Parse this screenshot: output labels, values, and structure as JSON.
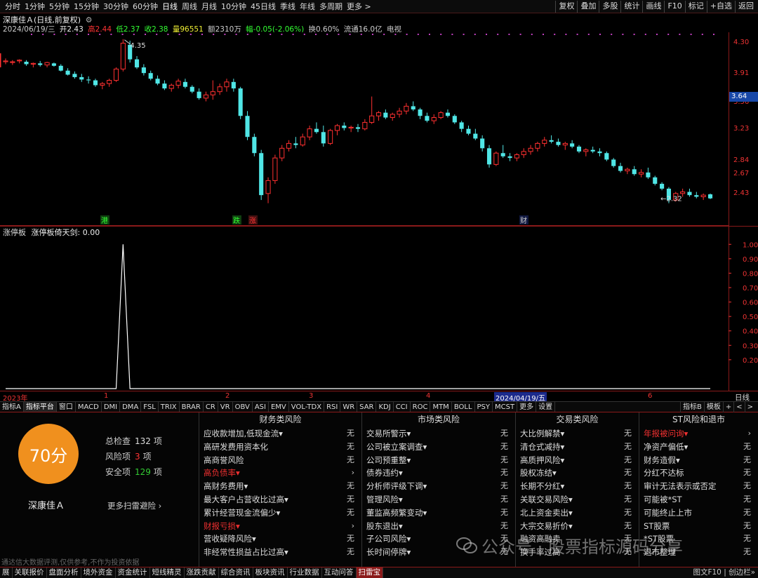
{
  "toolbar": {
    "periods": [
      "分时",
      "1分钟",
      "5分钟",
      "15分钟",
      "30分钟",
      "60分钟",
      "日线",
      "周线",
      "月线",
      "10分钟",
      "45日线",
      "季线",
      "年线",
      "多周期",
      "更多 >"
    ],
    "active_period": "日线",
    "right_buttons": [
      "复权",
      "叠加",
      "多股",
      "统计",
      "画线",
      "F10",
      "标记",
      "+自选",
      "返回"
    ]
  },
  "kline": {
    "title": "深康佳Ａ(日线,前复权)",
    "date": "2024/06/19/三",
    "open_label": "开2.43",
    "high_label": "高2.44",
    "low_label": "低2.37",
    "close_label": "收2.38",
    "volume_label": "量96551",
    "amount_label": "额2310万",
    "change_label": "幅-0.05(-2.06%)",
    "turnover_label": "换0.60%",
    "float_label": "流通16.0亿",
    "sector_label": "电视",
    "high_mark": "4.35",
    "low_mark": "←2.32",
    "price_ticks": [
      "4.30",
      "3.91",
      "3.56",
      "3.23",
      "2.84",
      "2.67",
      "2.43"
    ],
    "current_price": "3.64",
    "event_marks": [
      "港",
      "跌",
      "涨",
      "财"
    ]
  },
  "indicator": {
    "title": "涨停板",
    "subtitle": "涨停板倚天剑: 0.00",
    "ticks": [
      "1.00",
      "0.90",
      "0.80",
      "0.70",
      "0.60",
      "0.50",
      "0.40",
      "0.30",
      "0.20"
    ]
  },
  "timeaxis": {
    "labels": [
      "2023年",
      "1",
      "2",
      "3",
      "4",
      "6"
    ],
    "cursor_date": "2024/04/19/五",
    "period": "日线"
  },
  "indicator_tabs": [
    "指标A",
    "指标平台",
    "窗口",
    "MACD",
    "DMI",
    "DMA",
    "FSL",
    "TRIX",
    "BRAR",
    "CR",
    "VR",
    "OBV",
    "ASI",
    "EMV",
    "VOL-TDX",
    "RSI",
    "WR",
    "SAR",
    "KDJ",
    "CCI",
    "ROC",
    "MTM",
    "BOLL",
    "PSY",
    "MCST",
    "更多",
    "设置"
  ],
  "indicator_tabs_right": [
    "指标B",
    "模板",
    "+",
    "<",
    ">"
  ],
  "risk": {
    "score": "70分",
    "stock_name": "深康佳Ａ",
    "total_label": "总检查",
    "total_value": "132",
    "total_unit": "项",
    "risk_label": "风险项",
    "risk_value": "3",
    "risk_unit": "项",
    "safe_label": "安全项",
    "safe_value": "129",
    "safe_unit": "项",
    "more_scan": "更多扫雷避险 ›",
    "disclaimer": "通达信大数据评测,仅供参考,不作为投资依据",
    "columns": [
      {
        "title": "财务类风险",
        "items": [
          {
            "label": "应收款增加,低现金流▾",
            "value": "无"
          },
          {
            "label": "高研发费用资本化",
            "value": "无"
          },
          {
            "label": "高商誉风险",
            "value": "无"
          },
          {
            "label": "高负债率▾",
            "value": "›",
            "red": true
          },
          {
            "label": "高财务费用▾",
            "value": "无"
          },
          {
            "label": "最大客户占营收比过高▾",
            "value": "无"
          },
          {
            "label": "累计经营现金流偏少▾",
            "value": "无"
          },
          {
            "label": "财报亏损▾",
            "value": "›",
            "red": true
          },
          {
            "label": "营收疑降风险▾",
            "value": "无"
          },
          {
            "label": "非经常性损益占比过高▾",
            "value": "无"
          }
        ]
      },
      {
        "title": "市场类风险",
        "items": [
          {
            "label": "交易所警示▾",
            "value": "无"
          },
          {
            "label": "公司被立案调查▾",
            "value": "无"
          },
          {
            "label": "公司预重整▾",
            "value": "无"
          },
          {
            "label": "债券违约▾",
            "value": "无"
          },
          {
            "label": "分析师评级下调▾",
            "value": "无"
          },
          {
            "label": "管理风险▾",
            "value": "无"
          },
          {
            "label": "董监高频繁变动▾",
            "value": "无"
          },
          {
            "label": "股东退出▾",
            "value": "无"
          },
          {
            "label": "子公司风险▾",
            "value": "无"
          },
          {
            "label": "长时间停牌▾",
            "value": "无"
          }
        ]
      },
      {
        "title": "交易类风险",
        "items": [
          {
            "label": "大比例解禁▾",
            "value": "无"
          },
          {
            "label": "清仓式减持▾",
            "value": "无"
          },
          {
            "label": "高质押风险▾",
            "value": "无"
          },
          {
            "label": "股权冻结▾",
            "value": "无"
          },
          {
            "label": "长期不分红▾",
            "value": "无"
          },
          {
            "label": "关联交易风险▾",
            "value": "无"
          },
          {
            "label": "北上资金卖出▾",
            "value": "无"
          },
          {
            "label": "大宗交易折价▾",
            "value": "无"
          },
          {
            "label": "融资高融卖",
            "value": "无"
          },
          {
            "label": "换手率过高",
            "value": "无"
          }
        ]
      },
      {
        "title": "ST风险和退市",
        "items": [
          {
            "label": "年报被问询▾",
            "value": "›",
            "red": true
          },
          {
            "label": "净资产偏低▾",
            "value": "无"
          },
          {
            "label": "财务造假▾",
            "value": "无"
          },
          {
            "label": "分红不达标",
            "value": "无"
          },
          {
            "label": "审计无法表示或否定",
            "value": "无"
          },
          {
            "label": "可能被*ST",
            "value": "无"
          },
          {
            "label": "可能终止上市",
            "value": "无"
          },
          {
            "label": "ST股票",
            "value": "无"
          },
          {
            "label": "*ST股票",
            "value": "无"
          },
          {
            "label": "退市整理",
            "value": "无"
          }
        ]
      }
    ]
  },
  "watermark": "公众号 · 股票指标源码分享",
  "bottom_tabs": [
    "展",
    "关联报价",
    "盘面分析",
    "境外资金",
    "资金统计",
    "短线精灵",
    "涨跌贡献",
    "综合资讯",
    "板块资讯",
    "行业数据",
    "互动问答",
    "扫雷宝"
  ],
  "bottom_active": "扫雷宝",
  "bottom_right": "图文F10 | 创边栏»",
  "chart_data": {
    "type": "candlestick",
    "note_series": "daily OHLC, front-adjusted",
    "y_range": [
      2.3,
      4.4
    ],
    "candles": [
      [
        4.07,
        4.11,
        4.04,
        4.08
      ],
      [
        4.06,
        4.09,
        4.03,
        4.07
      ],
      [
        4.08,
        4.1,
        4.05,
        4.09
      ],
      [
        4.07,
        4.09,
        4.02,
        4.04
      ],
      [
        4.04,
        4.06,
        4.0,
        4.05
      ],
      [
        4.05,
        4.08,
        4.01,
        4.03
      ],
      [
        4.03,
        4.07,
        4.0,
        4.06
      ],
      [
        4.05,
        4.06,
        4.01,
        4.02
      ],
      [
        4.02,
        4.04,
        3.95,
        3.96
      ],
      [
        3.96,
        3.99,
        3.9,
        3.91
      ],
      [
        3.92,
        3.95,
        3.86,
        3.88
      ],
      [
        3.88,
        3.92,
        3.82,
        3.85
      ],
      [
        3.85,
        3.89,
        3.8,
        3.84
      ],
      [
        3.84,
        3.86,
        3.76,
        3.78
      ],
      [
        3.78,
        3.82,
        3.73,
        3.8
      ],
      [
        3.8,
        3.86,
        3.76,
        3.84
      ],
      [
        3.84,
        4.0,
        3.82,
        3.98
      ],
      [
        3.98,
        4.35,
        3.95,
        4.3
      ],
      [
        4.28,
        4.33,
        4.06,
        4.1
      ],
      [
        4.1,
        4.14,
        3.98,
        4.0
      ],
      [
        4.0,
        4.04,
        3.9,
        3.93
      ],
      [
        3.93,
        3.96,
        3.84,
        3.86
      ],
      [
        3.86,
        3.9,
        3.78,
        3.8
      ],
      [
        3.8,
        3.84,
        3.72,
        3.74
      ],
      [
        3.74,
        3.8,
        3.7,
        3.78
      ],
      [
        3.78,
        3.86,
        3.74,
        3.83
      ],
      [
        3.82,
        3.86,
        3.74,
        3.76
      ],
      [
        3.76,
        3.78,
        3.68,
        3.7
      ],
      [
        3.7,
        3.74,
        3.6,
        3.62
      ],
      [
        3.62,
        3.7,
        3.58,
        3.66
      ],
      [
        3.66,
        3.84,
        3.6,
        3.7
      ],
      [
        3.7,
        3.8,
        3.66,
        3.76
      ],
      [
        3.76,
        3.86,
        3.7,
        3.82
      ],
      [
        3.82,
        3.86,
        3.7,
        3.74
      ],
      [
        3.74,
        3.76,
        3.36,
        3.4
      ],
      [
        3.4,
        3.46,
        3.1,
        3.14
      ],
      [
        3.14,
        3.18,
        2.9,
        2.94
      ],
      [
        2.94,
        2.98,
        2.36,
        2.42
      ],
      [
        2.44,
        2.64,
        2.32,
        2.6
      ],
      [
        2.6,
        2.92,
        2.56,
        2.88
      ],
      [
        2.88,
        3.04,
        2.84,
        3.0
      ],
      [
        3.0,
        3.1,
        2.96,
        3.06
      ],
      [
        3.06,
        3.14,
        3.0,
        3.04
      ],
      [
        3.04,
        3.18,
        3.02,
        3.14
      ],
      [
        3.14,
        3.28,
        3.1,
        3.24
      ],
      [
        3.24,
        3.32,
        3.18,
        3.2
      ],
      [
        3.2,
        3.28,
        3.02,
        3.06
      ],
      [
        3.06,
        3.24,
        3.04,
        3.22
      ],
      [
        3.22,
        3.3,
        3.16,
        3.28
      ],
      [
        3.28,
        3.32,
        3.22,
        3.25
      ],
      [
        3.25,
        3.28,
        3.2,
        3.26
      ],
      [
        3.26,
        3.3,
        3.2,
        3.24
      ],
      [
        3.24,
        3.36,
        3.22,
        3.32
      ],
      [
        3.32,
        3.64,
        3.3,
        3.4
      ],
      [
        3.4,
        3.46,
        3.34,
        3.44
      ],
      [
        3.44,
        3.48,
        3.36,
        3.38
      ],
      [
        3.38,
        3.44,
        3.34,
        3.42
      ],
      [
        3.42,
        3.5,
        3.38,
        3.46
      ],
      [
        3.46,
        3.56,
        3.42,
        3.52
      ],
      [
        3.52,
        3.58,
        3.46,
        3.48
      ],
      [
        3.48,
        3.5,
        3.36,
        3.4
      ],
      [
        3.4,
        3.44,
        3.32,
        3.34
      ],
      [
        3.34,
        3.42,
        3.3,
        3.38
      ],
      [
        3.38,
        3.46,
        3.36,
        3.44
      ],
      [
        3.44,
        3.48,
        3.38,
        3.4
      ],
      [
        3.4,
        3.42,
        3.3,
        3.32
      ],
      [
        3.32,
        3.34,
        3.2,
        3.24
      ],
      [
        3.24,
        3.28,
        3.16,
        3.18
      ],
      [
        3.18,
        3.24,
        3.1,
        3.12
      ],
      [
        3.12,
        3.16,
        2.96,
        3.0
      ],
      [
        3.0,
        3.04,
        2.76,
        2.8
      ],
      [
        2.8,
        2.96,
        2.78,
        2.94
      ],
      [
        2.94,
        3.04,
        2.88,
        2.9
      ],
      [
        2.9,
        2.94,
        2.84,
        2.88
      ],
      [
        2.88,
        2.94,
        2.84,
        2.92
      ],
      [
        2.92,
        3.0,
        2.88,
        2.96
      ],
      [
        2.96,
        3.04,
        2.92,
        3.0
      ],
      [
        3.0,
        3.08,
        2.96,
        3.06
      ],
      [
        3.06,
        3.14,
        3.02,
        3.1
      ],
      [
        3.1,
        3.16,
        3.06,
        3.08
      ],
      [
        3.08,
        3.12,
        3.02,
        3.04
      ],
      [
        3.04,
        3.08,
        2.98,
        3.06
      ],
      [
        3.06,
        3.1,
        3.0,
        3.02
      ],
      [
        3.02,
        3.04,
        2.94,
        2.96
      ],
      [
        2.96,
        3.0,
        2.9,
        2.98
      ],
      [
        2.98,
        3.02,
        2.94,
        2.96
      ],
      [
        2.96,
        3.0,
        2.9,
        2.94
      ],
      [
        2.94,
        2.96,
        2.84,
        2.86
      ],
      [
        2.86,
        2.88,
        2.76,
        2.78
      ],
      [
        2.78,
        2.82,
        2.7,
        2.72
      ],
      [
        2.72,
        2.76,
        2.68,
        2.74
      ],
      [
        2.74,
        2.78,
        2.66,
        2.68
      ],
      [
        2.68,
        2.74,
        2.64,
        2.7
      ],
      [
        2.7,
        2.76,
        2.62,
        2.64
      ],
      [
        2.64,
        2.66,
        2.54,
        2.56
      ],
      [
        2.56,
        2.58,
        2.48,
        2.5
      ],
      [
        2.5,
        2.52,
        2.32,
        2.36
      ],
      [
        2.36,
        2.46,
        2.34,
        2.44
      ],
      [
        2.44,
        2.5,
        2.4,
        2.46
      ],
      [
        2.46,
        2.5,
        2.4,
        2.42
      ],
      [
        2.42,
        2.46,
        2.38,
        2.4
      ],
      [
        2.4,
        2.44,
        2.36,
        2.42
      ],
      [
        2.43,
        2.44,
        2.37,
        2.38
      ]
    ],
    "indicator_values": {
      "spike_index": 17,
      "spike_value": 1.0,
      "baseline": 0.0,
      "y_range": [
        0,
        1.05
      ]
    }
  }
}
